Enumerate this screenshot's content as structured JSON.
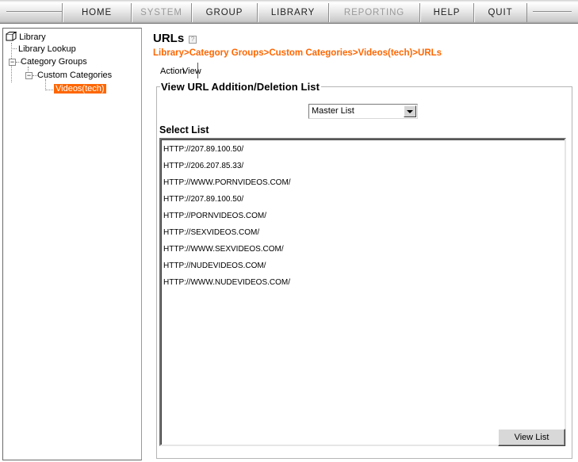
{
  "nav": {
    "items": [
      {
        "label": "HOME",
        "enabled": true
      },
      {
        "label": "SYSTEM",
        "enabled": false
      },
      {
        "label": "GROUP",
        "enabled": true
      },
      {
        "label": "LIBRARY",
        "enabled": true
      },
      {
        "label": "REPORTING",
        "enabled": false
      },
      {
        "label": "HELP",
        "enabled": true
      },
      {
        "label": "QUIT",
        "enabled": true
      }
    ]
  },
  "tree": {
    "root": "Library",
    "items": [
      {
        "label": "Library Lookup"
      },
      {
        "label": "Category Groups",
        "expander": "−"
      },
      {
        "label": "Custom Categories",
        "expander": "−"
      },
      {
        "label": "Videos(tech)",
        "selected": true
      }
    ]
  },
  "main": {
    "title": "URLs",
    "help_icon": "?",
    "breadcrumb": "Library>Category Groups>Custom Categories>Videos(tech)>URLs",
    "tabs": [
      {
        "label": "Action"
      },
      {
        "label": "View",
        "active": true
      }
    ],
    "group_title": "View URL Addition/Deletion List",
    "select": {
      "value": "Master List"
    },
    "list_label": "Select List",
    "urls": [
      "HTTP://207.89.100.50/",
      "HTTP://206.207.85.33/",
      "HTTP://WWW.PORNVIDEOS.COM/",
      "HTTP://207.89.100.50/",
      "HTTP://PORNVIDEOS.COM/",
      "HTTP://SEXVIDEOS.COM/",
      "HTTP://WWW.SEXVIDEOS.COM/",
      "HTTP://NUDEVIDEOS.COM/",
      "HTTP://WWW.NUDEVIDEOS.COM/"
    ],
    "view_button": "View List"
  },
  "colors": {
    "accent": "#ff6600",
    "nav_disabled": "#9a9a9a"
  }
}
